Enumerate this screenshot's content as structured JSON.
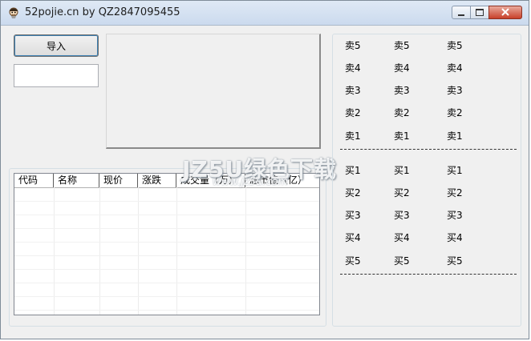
{
  "window": {
    "title": "52pojie.cn by QZ2847095455"
  },
  "buttons": {
    "import_label": "导入"
  },
  "input": {
    "value": ""
  },
  "table": {
    "columns": [
      "代码",
      "名称",
      "现价",
      "涨跌",
      "成交量（万）",
      "总市值（亿）"
    ]
  },
  "quotes": {
    "sell": [
      [
        "卖5",
        "卖5",
        "卖5"
      ],
      [
        "卖4",
        "卖4",
        "卖4"
      ],
      [
        "卖3",
        "卖3",
        "卖3"
      ],
      [
        "卖2",
        "卖2",
        "卖2"
      ],
      [
        "卖1",
        "卖1",
        "卖1"
      ]
    ],
    "buy": [
      [
        "买1",
        "买1",
        "买1"
      ],
      [
        "买2",
        "买2",
        "买2"
      ],
      [
        "买3",
        "买3",
        "买3"
      ],
      [
        "买4",
        "买4",
        "买4"
      ],
      [
        "买5",
        "买5",
        "买5"
      ]
    ]
  },
  "watermark": {
    "main": "JZ5U绿色下载",
    "sub": "www.jz5u.com"
  },
  "icons": {
    "app": "pirate-app-icon",
    "minimize": "minimize-icon",
    "maximize": "maximize-icon",
    "close": "close-icon"
  },
  "colors": {
    "close_button": "#c8402a",
    "titlebar": "#cbdaee"
  }
}
